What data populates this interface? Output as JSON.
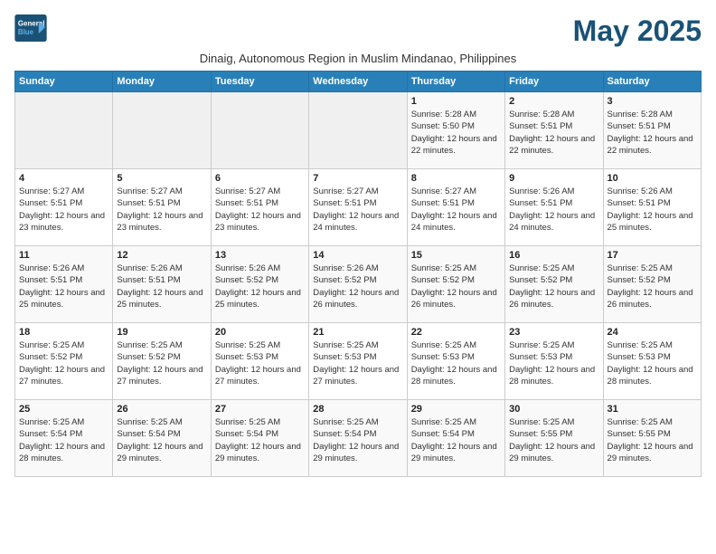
{
  "header": {
    "logo_line1": "General",
    "logo_line2": "Blue",
    "month_year": "May 2025",
    "subtitle": "Dinaig, Autonomous Region in Muslim Mindanao, Philippines"
  },
  "weekdays": [
    "Sunday",
    "Monday",
    "Tuesday",
    "Wednesday",
    "Thursday",
    "Friday",
    "Saturday"
  ],
  "weeks": [
    [
      {
        "day": "",
        "detail": ""
      },
      {
        "day": "",
        "detail": ""
      },
      {
        "day": "",
        "detail": ""
      },
      {
        "day": "",
        "detail": ""
      },
      {
        "day": "1",
        "detail": "Sunrise: 5:28 AM\nSunset: 5:50 PM\nDaylight: 12 hours\nand 22 minutes."
      },
      {
        "day": "2",
        "detail": "Sunrise: 5:28 AM\nSunset: 5:51 PM\nDaylight: 12 hours\nand 22 minutes."
      },
      {
        "day": "3",
        "detail": "Sunrise: 5:28 AM\nSunset: 5:51 PM\nDaylight: 12 hours\nand 22 minutes."
      }
    ],
    [
      {
        "day": "4",
        "detail": "Sunrise: 5:27 AM\nSunset: 5:51 PM\nDaylight: 12 hours\nand 23 minutes."
      },
      {
        "day": "5",
        "detail": "Sunrise: 5:27 AM\nSunset: 5:51 PM\nDaylight: 12 hours\nand 23 minutes."
      },
      {
        "day": "6",
        "detail": "Sunrise: 5:27 AM\nSunset: 5:51 PM\nDaylight: 12 hours\nand 23 minutes."
      },
      {
        "day": "7",
        "detail": "Sunrise: 5:27 AM\nSunset: 5:51 PM\nDaylight: 12 hours\nand 24 minutes."
      },
      {
        "day": "8",
        "detail": "Sunrise: 5:27 AM\nSunset: 5:51 PM\nDaylight: 12 hours\nand 24 minutes."
      },
      {
        "day": "9",
        "detail": "Sunrise: 5:26 AM\nSunset: 5:51 PM\nDaylight: 12 hours\nand 24 minutes."
      },
      {
        "day": "10",
        "detail": "Sunrise: 5:26 AM\nSunset: 5:51 PM\nDaylight: 12 hours\nand 25 minutes."
      }
    ],
    [
      {
        "day": "11",
        "detail": "Sunrise: 5:26 AM\nSunset: 5:51 PM\nDaylight: 12 hours\nand 25 minutes."
      },
      {
        "day": "12",
        "detail": "Sunrise: 5:26 AM\nSunset: 5:51 PM\nDaylight: 12 hours\nand 25 minutes."
      },
      {
        "day": "13",
        "detail": "Sunrise: 5:26 AM\nSunset: 5:52 PM\nDaylight: 12 hours\nand 25 minutes."
      },
      {
        "day": "14",
        "detail": "Sunrise: 5:26 AM\nSunset: 5:52 PM\nDaylight: 12 hours\nand 26 minutes."
      },
      {
        "day": "15",
        "detail": "Sunrise: 5:25 AM\nSunset: 5:52 PM\nDaylight: 12 hours\nand 26 minutes."
      },
      {
        "day": "16",
        "detail": "Sunrise: 5:25 AM\nSunset: 5:52 PM\nDaylight: 12 hours\nand 26 minutes."
      },
      {
        "day": "17",
        "detail": "Sunrise: 5:25 AM\nSunset: 5:52 PM\nDaylight: 12 hours\nand 26 minutes."
      }
    ],
    [
      {
        "day": "18",
        "detail": "Sunrise: 5:25 AM\nSunset: 5:52 PM\nDaylight: 12 hours\nand 27 minutes."
      },
      {
        "day": "19",
        "detail": "Sunrise: 5:25 AM\nSunset: 5:52 PM\nDaylight: 12 hours\nand 27 minutes."
      },
      {
        "day": "20",
        "detail": "Sunrise: 5:25 AM\nSunset: 5:53 PM\nDaylight: 12 hours\nand 27 minutes."
      },
      {
        "day": "21",
        "detail": "Sunrise: 5:25 AM\nSunset: 5:53 PM\nDaylight: 12 hours\nand 27 minutes."
      },
      {
        "day": "22",
        "detail": "Sunrise: 5:25 AM\nSunset: 5:53 PM\nDaylight: 12 hours\nand 28 minutes."
      },
      {
        "day": "23",
        "detail": "Sunrise: 5:25 AM\nSunset: 5:53 PM\nDaylight: 12 hours\nand 28 minutes."
      },
      {
        "day": "24",
        "detail": "Sunrise: 5:25 AM\nSunset: 5:53 PM\nDaylight: 12 hours\nand 28 minutes."
      }
    ],
    [
      {
        "day": "25",
        "detail": "Sunrise: 5:25 AM\nSunset: 5:54 PM\nDaylight: 12 hours\nand 28 minutes."
      },
      {
        "day": "26",
        "detail": "Sunrise: 5:25 AM\nSunset: 5:54 PM\nDaylight: 12 hours\nand 29 minutes."
      },
      {
        "day": "27",
        "detail": "Sunrise: 5:25 AM\nSunset: 5:54 PM\nDaylight: 12 hours\nand 29 minutes."
      },
      {
        "day": "28",
        "detail": "Sunrise: 5:25 AM\nSunset: 5:54 PM\nDaylight: 12 hours\nand 29 minutes."
      },
      {
        "day": "29",
        "detail": "Sunrise: 5:25 AM\nSunset: 5:54 PM\nDaylight: 12 hours\nand 29 minutes."
      },
      {
        "day": "30",
        "detail": "Sunrise: 5:25 AM\nSunset: 5:55 PM\nDaylight: 12 hours\nand 29 minutes."
      },
      {
        "day": "31",
        "detail": "Sunrise: 5:25 AM\nSunset: 5:55 PM\nDaylight: 12 hours\nand 29 minutes."
      }
    ]
  ]
}
